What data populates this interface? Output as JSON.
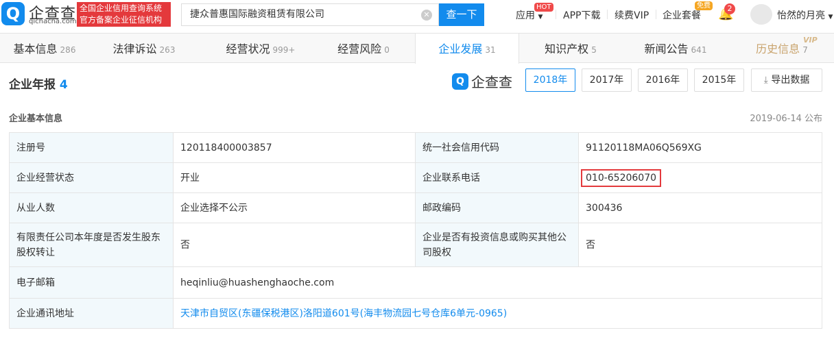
{
  "header": {
    "logo_text": "企查查",
    "logo_domain": "qichacha.com",
    "slogan_line1": "全国企业信用查询系统",
    "slogan_line2": "官方备案企业征信机构",
    "search_value": "捷众普惠国际融资租赁有限公司",
    "search_button": "查一下",
    "nav": {
      "apps": "应用",
      "apps_badge": "HOT",
      "app_download": "APP下载",
      "renew_vip": "续费VIP",
      "enterprise_package": "企业套餐",
      "package_badge": "免费",
      "notification_count": "2",
      "username": "怡然的月亮"
    }
  },
  "tabs": [
    {
      "label": "基本信息",
      "count": "286"
    },
    {
      "label": "法律诉讼",
      "count": "263"
    },
    {
      "label": "经营状况",
      "count": "999+"
    },
    {
      "label": "经营风险",
      "count": "0"
    },
    {
      "label": "企业发展",
      "count": "31"
    },
    {
      "label": "知识产权",
      "count": "5"
    },
    {
      "label": "新闻公告",
      "count": "641"
    },
    {
      "label": "历史信息",
      "count": "7",
      "badge": "VIP"
    }
  ],
  "section": {
    "title": "企业年报",
    "count": "4",
    "watermark": "企查查",
    "years": [
      "2018年",
      "2017年",
      "2016年",
      "2015年"
    ],
    "export": "导出数据",
    "subtitle": "企业基本信息",
    "published": "2019-06-14 公布"
  },
  "table": [
    [
      "注册号",
      "120118400003857",
      "统一社会信用代码",
      "91120118MA06Q569XG"
    ],
    [
      "企业经营状态",
      "开业",
      "企业联系电话",
      "010-65206070"
    ],
    [
      "从业人数",
      "企业选择不公示",
      "邮政编码",
      "300436"
    ],
    [
      "有限责任公司本年度是否发生股东股权转让",
      "否",
      "企业是否有投资信息或购买其他公司股权",
      "否"
    ],
    [
      "电子邮箱",
      "heqinliu@huashenghaoche.com"
    ],
    [
      "企业通讯地址",
      "天津市自贸区(东疆保税港区)洛阳道601号(海丰物流园七号仓库6单元-0965)"
    ]
  ]
}
